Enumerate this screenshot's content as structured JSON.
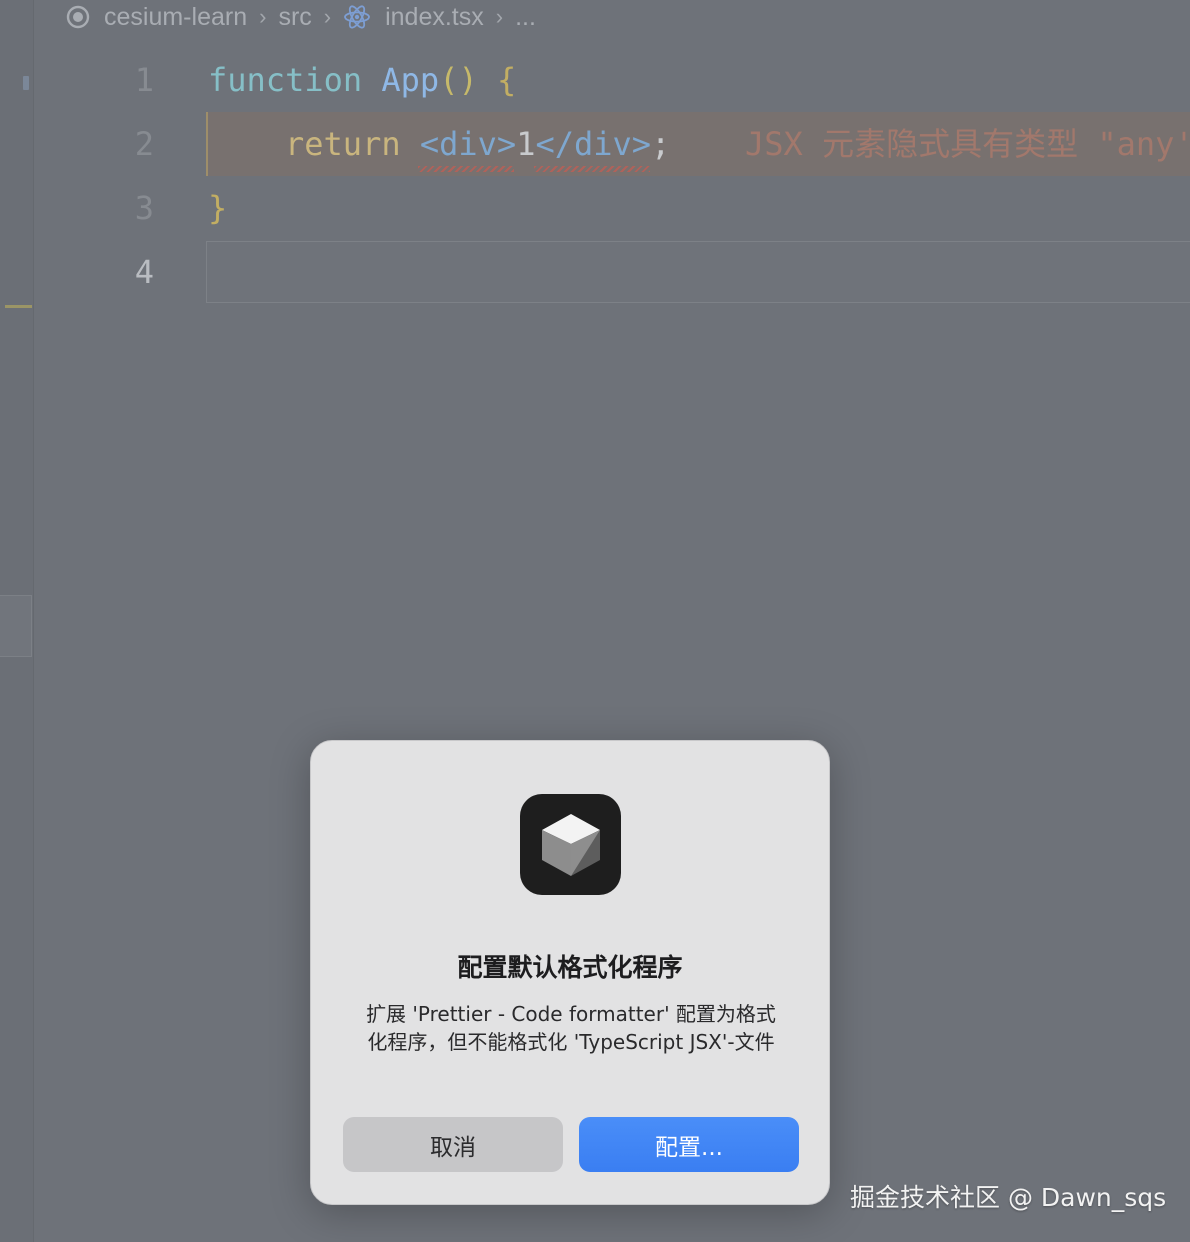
{
  "breadcrumb": {
    "project": "cesium-learn",
    "folder": "src",
    "file": "index.tsx",
    "more": "...",
    "separator": "›"
  },
  "editor": {
    "lines": [
      {
        "number": "1"
      },
      {
        "number": "2"
      },
      {
        "number": "3"
      },
      {
        "number": "4"
      }
    ],
    "line1": {
      "keyword": "function",
      "name": "App",
      "paren": "()",
      "brace": "{"
    },
    "line2": {
      "keyword": "return",
      "open_tag": "<div>",
      "text": "1",
      "close_tag": "</div>",
      "semicolon": ";"
    },
    "line3": {
      "brace": "}"
    },
    "error_message": "JSX 元素隐式具有类型 \"any'"
  },
  "dialog": {
    "title": "配置默认格式化程序",
    "message": "扩展 'Prettier - Code formatter' 配置为格式化程序，但不能格式化 'TypeScript JSX'-文件",
    "cancel_label": "取消",
    "configure_label": "配置..."
  },
  "watermark": "掘金技术社区 @ Dawn_sqs",
  "colors": {
    "accent_button": "#3f85f7",
    "error_text": "#a2786c",
    "background": "#6e7279"
  }
}
